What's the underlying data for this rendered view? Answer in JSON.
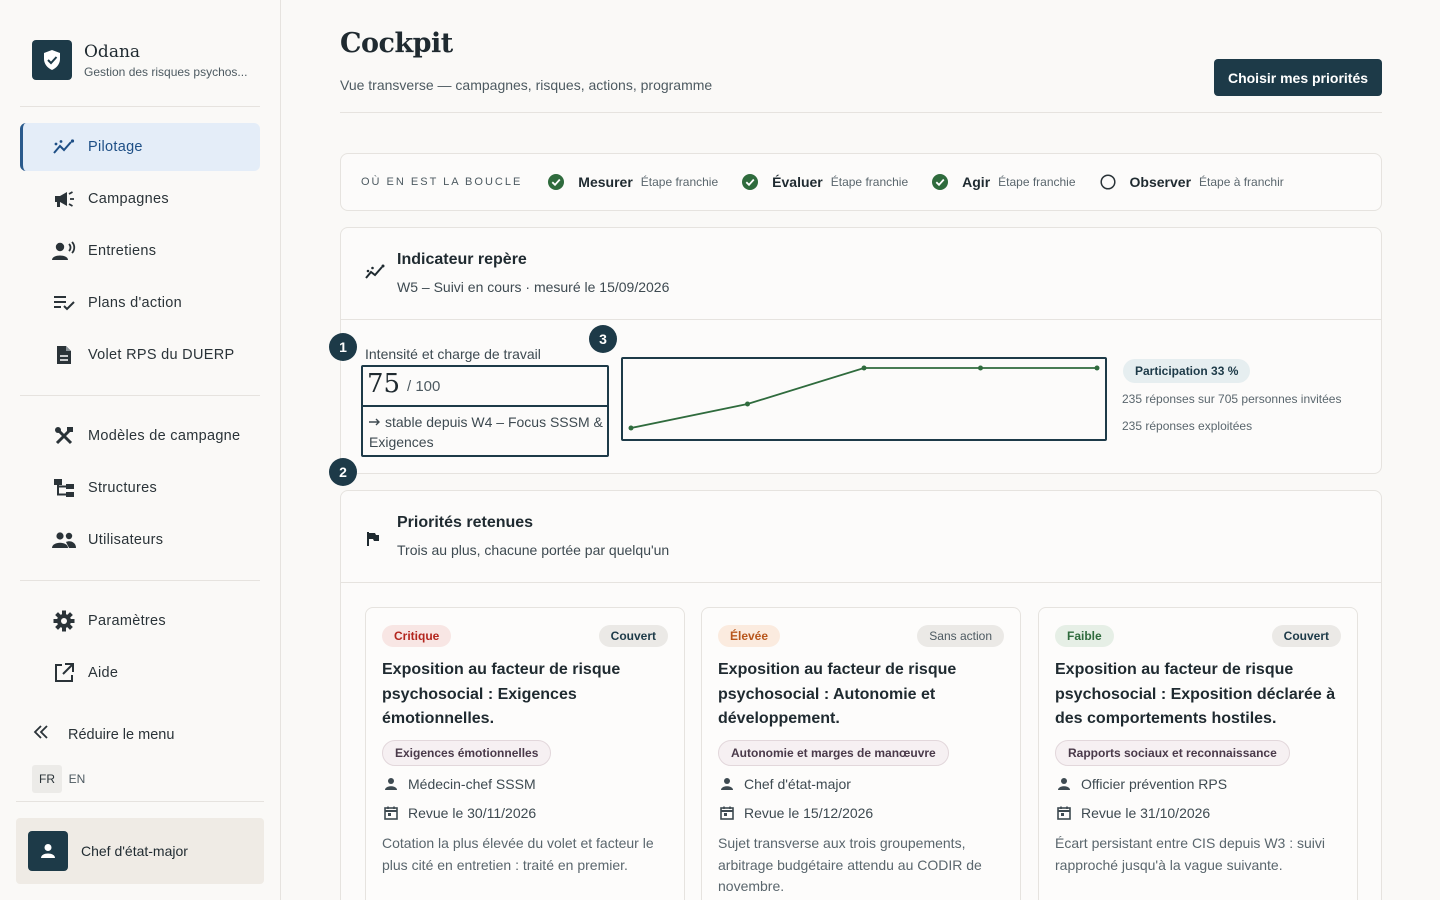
{
  "brand": {
    "name": "Odana",
    "subtitle": "Gestion des risques psychos..."
  },
  "sidebar": {
    "nav": [
      {
        "label": "Pilotage",
        "icon": "trend-icon",
        "active": true
      },
      {
        "label": "Campagnes",
        "icon": "megaphone-icon"
      },
      {
        "label": "Entretiens",
        "icon": "speaking-person-icon"
      },
      {
        "label": "Plans d'action",
        "icon": "checklist-icon"
      },
      {
        "label": "Volet RPS du DUERP",
        "icon": "document-icon"
      }
    ],
    "admin": [
      {
        "label": "Modèles de campagne",
        "icon": "tools-icon"
      },
      {
        "label": "Structures",
        "icon": "tree-icon"
      },
      {
        "label": "Utilisateurs",
        "icon": "people-icon"
      }
    ],
    "footer_nav": [
      {
        "label": "Paramètres",
        "icon": "gear-icon"
      },
      {
        "label": "Aide",
        "icon": "external-link-icon"
      }
    ],
    "collapse_label": "Réduire le menu",
    "languages": [
      "FR",
      "EN"
    ],
    "active_language": "FR",
    "user": {
      "name": "Chef d'état-major"
    }
  },
  "header": {
    "title": "Cockpit",
    "subtitle": "Vue transverse — campagnes, risques, actions, programme",
    "cta_label": "Choisir mes priorités"
  },
  "loop": {
    "title": "OÙ EN EST LA BOUCLE",
    "steps": [
      {
        "name": "Mesurer",
        "state": "Étape franchie",
        "done": true
      },
      {
        "name": "Évaluer",
        "state": "Étape franchie",
        "done": true
      },
      {
        "name": "Agir",
        "state": "Étape franchie",
        "done": true
      },
      {
        "name": "Observer",
        "state": "Étape à franchir",
        "done": false
      }
    ]
  },
  "indicator": {
    "title": "Indicateur repère",
    "subtitle": "W5 – Suivi en cours · mesuré le 15/09/2026",
    "metric_label": "Intensité et charge de travail",
    "value": "75",
    "max": "/ 100",
    "trend": "stable depuis W4 – Focus SSSM & Exigences",
    "markers": [
      "1",
      "2",
      "3"
    ],
    "participation_badge": "Participation 33 %",
    "responses_line": "235 réponses sur 705 personnes invitées",
    "exploited_line": "235 réponses exploitées",
    "sparkline": [
      55,
      61,
      70,
      70,
      70
    ]
  },
  "priorities": {
    "title": "Priorités retenues",
    "subtitle": "Trois au plus, chacune portée par quelqu'un",
    "cards": [
      {
        "severity": "Critique",
        "coverage": "Couvert",
        "title": "Exposition au facteur de risque psychosocial : Exigences émotionnelles.",
        "tag": "Exigences émotionnelles",
        "owner": "Médecin-chef SSSM",
        "review": "Revue le 30/11/2026",
        "description": "Cotation la plus élevée du volet et facteur le plus cité en entretien : traité en premier."
      },
      {
        "severity": "Élevée",
        "coverage": "Sans action",
        "title": "Exposition au facteur de risque psychosocial : Autonomie et développement.",
        "tag": "Autonomie et marges de manœuvre",
        "owner": "Chef d'état-major",
        "review": "Revue le 15/12/2026",
        "description": "Sujet transverse aux trois groupements, arbitrage budgétaire attendu au CODIR de novembre."
      },
      {
        "severity": "Faible",
        "coverage": "Couvert",
        "title": "Exposition au facteur de risque psychosocial : Exposition déclarée à des comportements hostiles.",
        "tag": "Rapports sociaux et reconnaissance",
        "owner": "Officier prévention RPS",
        "review": "Revue le 31/10/2026",
        "description": "Écart persistant entre CIS depuis W3 : suivi rapproché jusqu'à la vague suivante."
      }
    ]
  },
  "colors": {
    "primary": "#1d3a48",
    "accent": "#2a5a8c",
    "success": "#2f6b3d",
    "critique": "#b3261e",
    "elevee": "#b8561c",
    "faible": "#2f6b3d"
  }
}
